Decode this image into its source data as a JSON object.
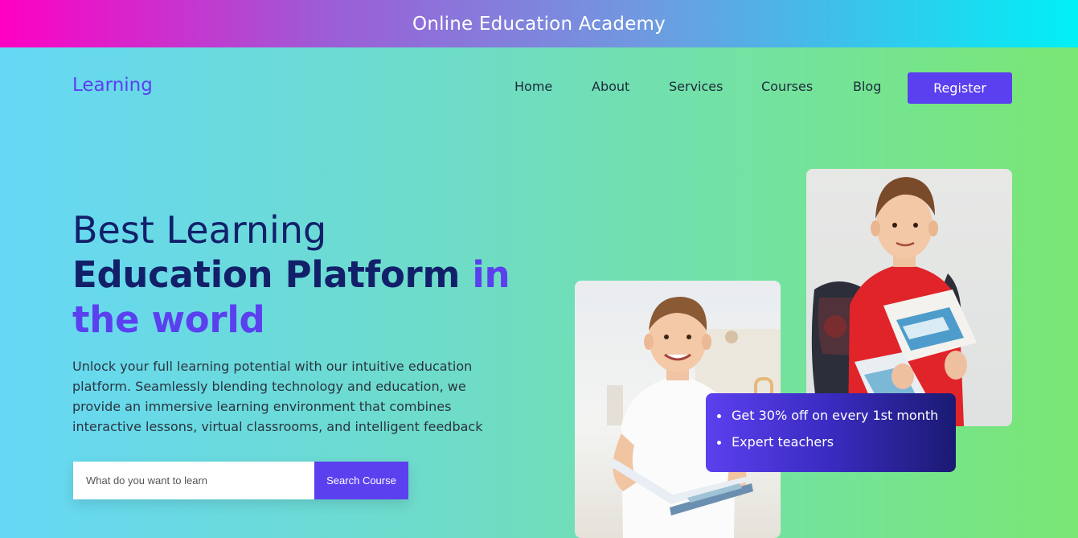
{
  "banner": {
    "title": "Online Education Academy"
  },
  "header": {
    "logo": "Learning",
    "nav": [
      "Home",
      "About",
      "Services",
      "Courses",
      "Blog"
    ],
    "register_label": "Register"
  },
  "hero": {
    "title_line1": "Best Learning",
    "title_line2_main": "Education Platform",
    "title_line2_accent": "in",
    "title_line3": "the world",
    "description": "Unlock your full learning potential with our intuitive education platform. Seamlessly blending technology and education, we provide an immersive learning environment that combines interactive lessons, virtual classrooms, and intelligent feedback"
  },
  "search": {
    "placeholder": "What do you want to learn",
    "button_label": "Search Course"
  },
  "promo": {
    "items": [
      "Get 30% off on every 1st month",
      "Expert teachers"
    ]
  },
  "colors": {
    "accent": "#5b40ef",
    "heading": "#12206a"
  }
}
